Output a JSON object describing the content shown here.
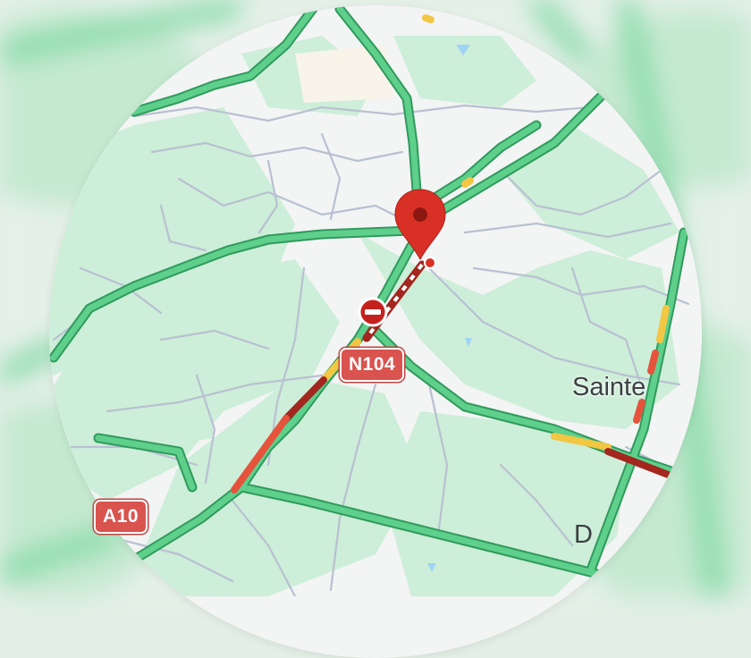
{
  "map": {
    "roads": {
      "shield_n104": "N104",
      "shield_a10": "A10"
    },
    "places": {
      "town_label": "Sainte",
      "partial_label": "D"
    },
    "pin": {
      "icon": "location-pin-icon",
      "color": "#d93025"
    },
    "incident": {
      "icon": "road-closed-icon",
      "color": "#c5221f"
    },
    "traffic_colors": {
      "free_flow": "#5fcf8c",
      "slow": "#f2c744",
      "heavy": "#e5533d",
      "stopped": "#a3271f"
    },
    "colors": {
      "park": "#cdeed8",
      "background": "#f3f4f4",
      "minor_road": "#b9c0d2"
    }
  }
}
